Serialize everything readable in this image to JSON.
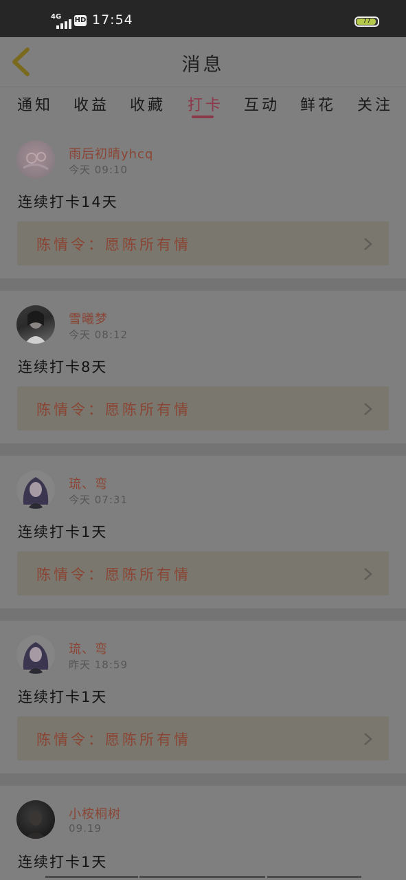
{
  "status_bar": {
    "network": "4G",
    "hd": "HD",
    "time": "17:54",
    "battery_level": "77"
  },
  "header": {
    "title": "消息",
    "back_icon": "chevron-left-icon"
  },
  "tabs": [
    {
      "label": "通知",
      "active": false
    },
    {
      "label": "收益",
      "active": false
    },
    {
      "label": "收藏",
      "active": false
    },
    {
      "label": "打卡",
      "active": true
    },
    {
      "label": "互动",
      "active": false
    },
    {
      "label": "鲜花",
      "active": false
    },
    {
      "label": "关注",
      "active": false
    }
  ],
  "items": [
    {
      "name": "雨后初晴yhcq",
      "time": "今天 09:10",
      "message": "连续打卡14天",
      "topic": "陈情令：愿陈所有情"
    },
    {
      "name": "雪曦梦",
      "time": "今天 08:12",
      "message": "连续打卡8天",
      "topic": "陈情令：愿陈所有情"
    },
    {
      "name": "琉、弯",
      "time": "今天 07:31",
      "message": "连续打卡1天",
      "topic": "陈情令：愿陈所有情"
    },
    {
      "name": "琉、弯",
      "time": "昨天 18:59",
      "message": "连续打卡1天",
      "topic": "陈情令：愿陈所有情"
    },
    {
      "name": "小桉桐树",
      "time": "09.19",
      "message": "连续打卡1天"
    }
  ],
  "colors": {
    "accent": "#8c3a4a",
    "name_color": "#8a4534",
    "overlay_bg": "#7f7f7f"
  }
}
